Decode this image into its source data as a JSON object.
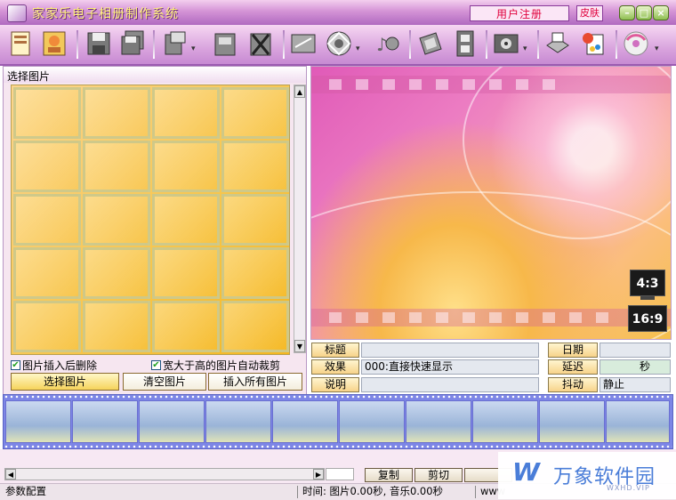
{
  "window": {
    "title": "家家乐电子相册制作系统",
    "register_label": "用户注册",
    "skin_label": "皮肤"
  },
  "toolbar": {
    "icons": [
      "new-album-icon",
      "open-photos-icon",
      "save-icon",
      "save-all-icon",
      "add-page-icon",
      "page-icon",
      "delete-page-icon",
      "edit-text-icon",
      "disc-icon",
      "music-icon",
      "settings-icon",
      "film-icon",
      "preview-icon",
      "print-icon",
      "paint-palette-icon",
      "burn-disc-icon"
    ]
  },
  "left_panel": {
    "header": "选择图片",
    "checkbox_delete_after_insert": "图片插入后删除",
    "checkbox_auto_crop": "宽大于高的图片自动裁剪",
    "btn_select": "选择图片",
    "btn_clear": "清空图片",
    "btn_insert_all": "插入所有图片"
  },
  "preview": {
    "ratio_4_3": "4:3",
    "ratio_16_9": "16:9"
  },
  "info": {
    "title_label": "标题",
    "title_value": "",
    "effect_label": "效果",
    "effect_value": "000:直接快速显示",
    "desc_label": "说明",
    "desc_value": "",
    "date_label": "日期",
    "date_value": "",
    "delay_label": "延迟",
    "delay_unit": "秒",
    "shake_label": "抖动",
    "shake_value": "静止"
  },
  "bottom": {
    "copy": "复制",
    "cut": "剪切"
  },
  "status": {
    "left": "参数配置",
    "time": "时间: 图片0.00秒, 音乐0.00秒",
    "right": "www"
  },
  "watermark": {
    "logo": "W",
    "name": "万象软件园",
    "url": "WXHD.VIP"
  },
  "colors": {
    "title_text": "#fff27a",
    "register_text": "#e0003c",
    "timeline": "#7d86e6"
  }
}
